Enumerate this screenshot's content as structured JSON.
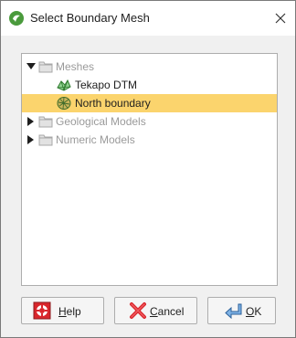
{
  "window": {
    "title": "Select Boundary Mesh",
    "close_glyph": "✕",
    "app_icon": "leapfrog-app-icon"
  },
  "tree": {
    "items": [
      {
        "label": "Meshes",
        "icon": "folder-icon",
        "expanded": true,
        "enabled": false
      },
      {
        "label": "Tekapo DTM",
        "icon": "dtm-mesh-icon",
        "enabled": true,
        "selected": false
      },
      {
        "label": "North boundary",
        "icon": "boundary-mesh-icon",
        "enabled": true,
        "selected": true
      },
      {
        "label": "Geological Models",
        "icon": "folder-icon",
        "expanded": false,
        "enabled": false
      },
      {
        "label": "Numeric Models",
        "icon": "folder-icon",
        "expanded": false,
        "enabled": false
      }
    ]
  },
  "buttons": {
    "help": {
      "mnemonic": "H",
      "rest": "elp",
      "icon": "help-lifebuoy-icon"
    },
    "cancel": {
      "mnemonic": "C",
      "rest": "ancel",
      "icon": "cancel-x-icon"
    },
    "ok": {
      "mnemonic": "O",
      "rest": "K",
      "icon": "ok-enter-arrow-icon"
    }
  },
  "colors": {
    "selection": "#fbd46d",
    "disabled_text": "#9a9a9a",
    "folder": "#c9c9c9",
    "mesh_green": "#3a8a3a"
  }
}
